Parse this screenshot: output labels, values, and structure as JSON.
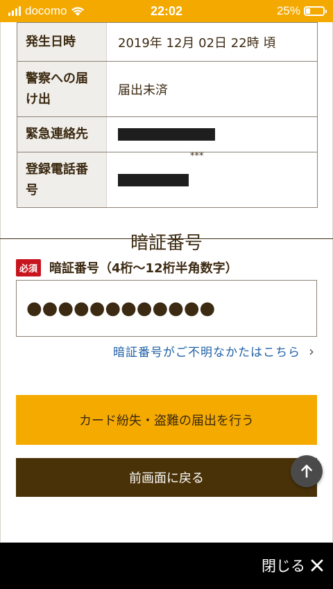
{
  "status_bar": {
    "carrier": "docomo",
    "time": "22:02",
    "battery_text": "25%",
    "battery_level": 0.25,
    "signal_icon": "signal-bars-icon",
    "wifi_icon": "wifi-icon"
  },
  "info_table": {
    "rows": [
      {
        "label": "発生日時",
        "value": "2019年 12月 02日 22時 頃"
      },
      {
        "label": "警察への届け出",
        "value": "届出未済"
      },
      {
        "label": "緊急連絡先",
        "value": ""
      },
      {
        "label": "登録電話番号",
        "value": "***"
      }
    ]
  },
  "pin_section": {
    "title": "暗証番号",
    "required_badge": "必須",
    "field_label": "暗証番号（4桁〜12桁半角数字）",
    "masked_value": "●●●●●●●●●●●●",
    "forgot_link": "暗証番号がご不明なかたはこちら"
  },
  "actions": {
    "report_button": "カード紛失・盗難の届出を行う",
    "back_button": "前画面に戻る",
    "scroll_top_icon": "arrow-up-icon"
  },
  "bottom_bar": {
    "close_label": "閉じる"
  },
  "colors": {
    "brand_yellow": "#f5aa00",
    "brand_brown": "#4a3208",
    "required_red": "#c8141e",
    "link_blue": "#1f5fa6"
  }
}
